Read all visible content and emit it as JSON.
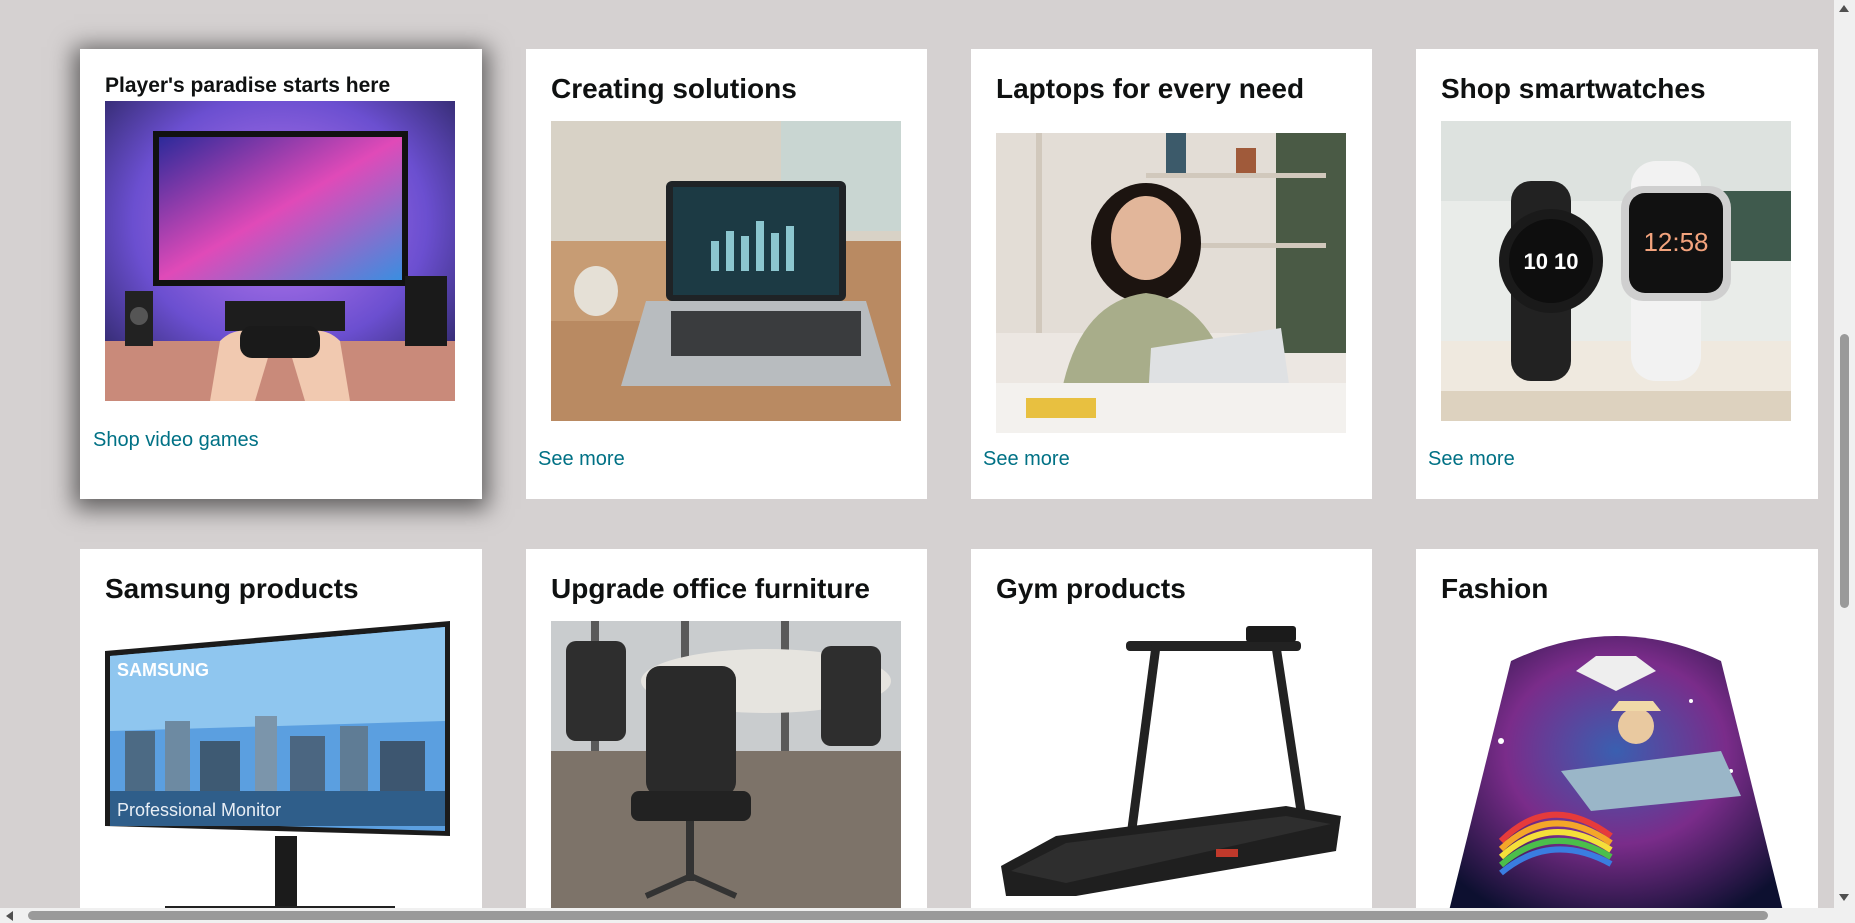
{
  "cards": [
    {
      "title": "Player's paradise starts here",
      "link": "Shop video games",
      "image": "gaming-setup-photo"
    },
    {
      "title": "Creating solutions",
      "link": "See more",
      "image": "laptop-dashboard-photo"
    },
    {
      "title": "Laptops for every need",
      "link": "See more",
      "image": "woman-using-laptop-photo"
    },
    {
      "title": "Shop smartwatches",
      "link": "See more",
      "image": "smartwatches-photo"
    },
    {
      "title": "Samsung products",
      "image": "samsung-monitor-photo",
      "image_text": [
        "SAMSUNG",
        "Professional Monitor"
      ]
    },
    {
      "title": "Upgrade office furniture",
      "image": "office-chairs-photo"
    },
    {
      "title": "Gym products",
      "image": "treadmill-photo"
    },
    {
      "title": "Fashion",
      "image": "galaxy-hoodie-photo"
    }
  ],
  "watch_faces": {
    "left": "10 10",
    "right": "12:58"
  },
  "colors": {
    "background": "#d5d1d1",
    "card": "#ffffff",
    "link": "#007185",
    "title": "#0f1111"
  }
}
